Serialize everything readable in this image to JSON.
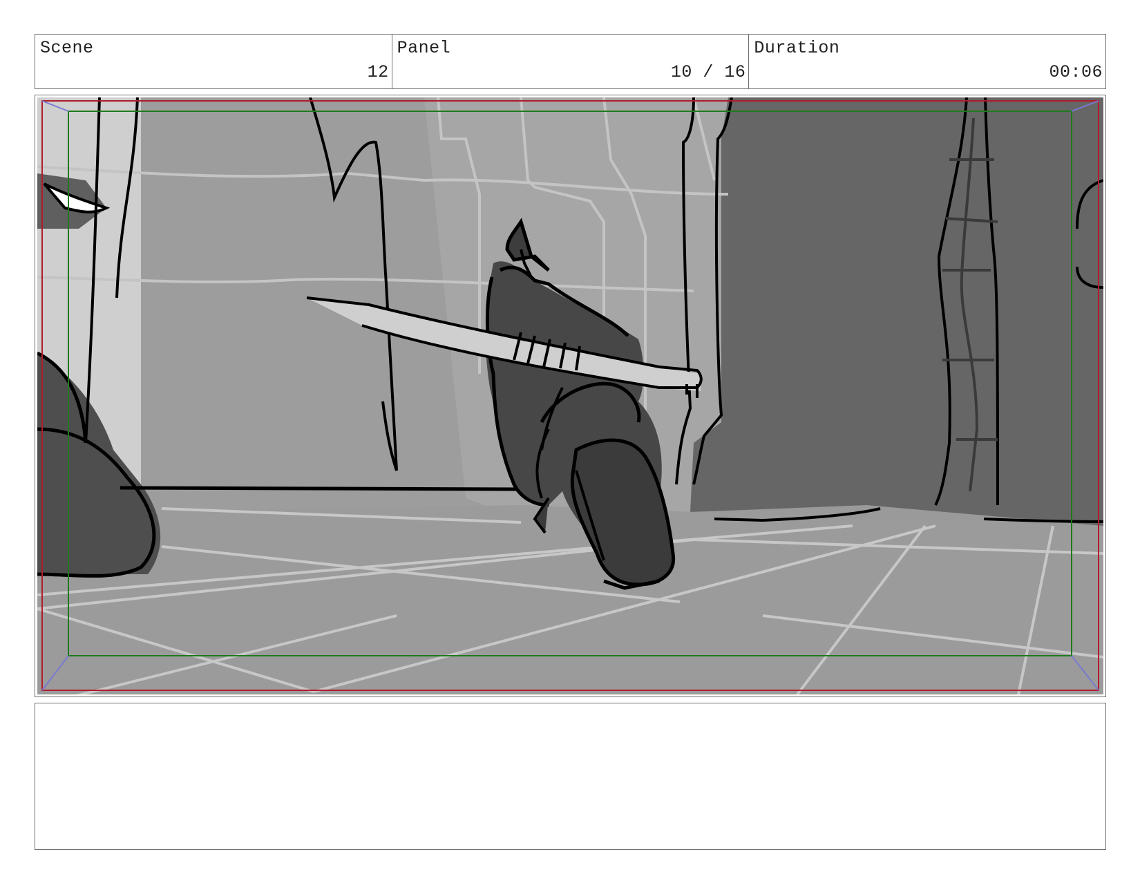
{
  "header": {
    "scene_label": "Scene",
    "scene_value": "12",
    "panel_label": "Panel",
    "panel_value": "10 / 16",
    "duration_label": "Duration",
    "duration_value": "00:06"
  },
  "panel": {
    "safe_frame_outer_color": "#b01c2c",
    "safe_frame_inner_color": "#1f7a1f",
    "corner_marker_color": "#7a7ad0"
  },
  "notes": {
    "text": ""
  }
}
